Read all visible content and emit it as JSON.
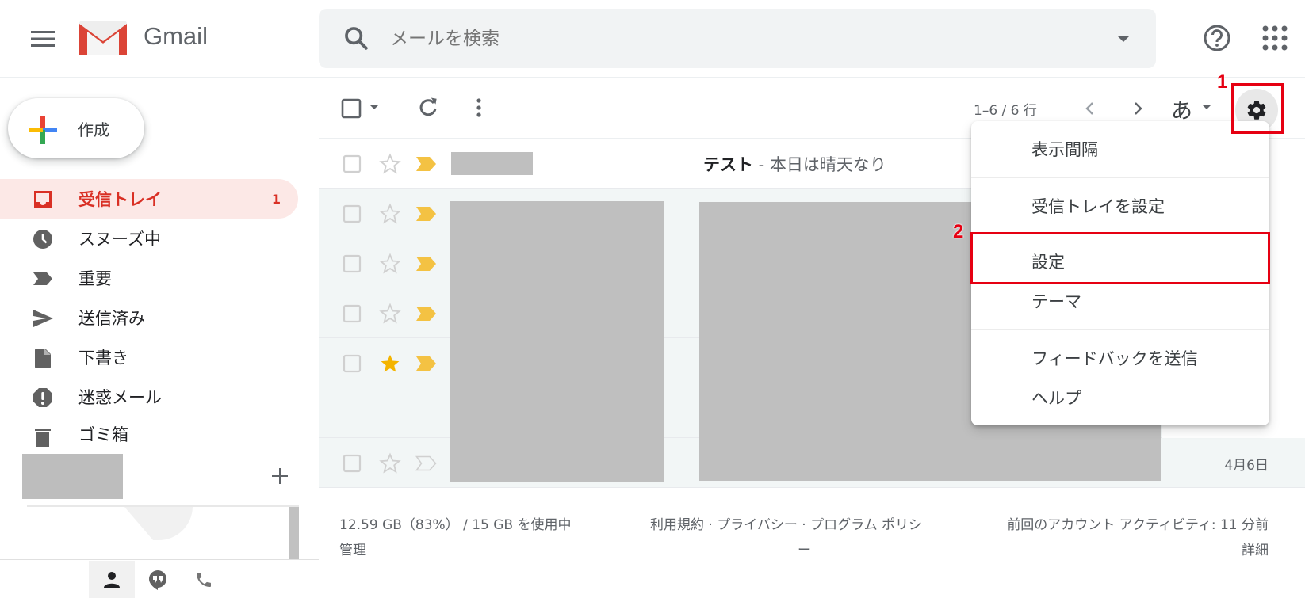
{
  "header": {
    "brand": "Gmail",
    "search_placeholder": "メールを検索"
  },
  "compose": {
    "label": "作成"
  },
  "sidebar": {
    "items": [
      {
        "label": "受信トレイ",
        "count": "1",
        "icon": "inbox-icon",
        "active": true
      },
      {
        "label": "スヌーズ中",
        "icon": "clock-icon"
      },
      {
        "label": "重要",
        "icon": "important-icon"
      },
      {
        "label": "送信済み",
        "icon": "send-icon"
      },
      {
        "label": "下書き",
        "icon": "draft-icon"
      },
      {
        "label": "迷惑メール",
        "icon": "spam-icon"
      },
      {
        "label": "ゴミ箱",
        "icon": "trash-icon"
      }
    ]
  },
  "toolbar": {
    "page_range": "1–6 / 6 行",
    "input_tool": "あ"
  },
  "emails": [
    {
      "subject": "テスト",
      "snippet": " - 本日は晴天なり",
      "starred": false,
      "important": true,
      "unread": true
    },
    {
      "starred": false,
      "important": true
    },
    {
      "starred": false,
      "important": true
    },
    {
      "starred": false,
      "important": true
    },
    {
      "starred": true,
      "important": true
    },
    {
      "starred": false,
      "important": false,
      "date": "4月6日"
    }
  ],
  "settings_menu": {
    "items": [
      "表示間隔",
      "受信トレイを設定",
      "設定",
      "テーマ",
      "フィードバックを送信",
      "ヘルプ"
    ]
  },
  "annotations": {
    "step1": "1",
    "step2": "2",
    "color": "#e60012"
  },
  "footer": {
    "storage": "12.59 GB（83%） / 15 GB を使用中",
    "storage_percent": 83,
    "manage": "管理",
    "links": "利用規約 · プライバシー · プログラム ポリシ",
    "links_cont": "ー",
    "activity": "前回のアカウント アクティビティ: 11 分前",
    "details": "詳細"
  },
  "colors": {
    "accent_red": "#d93025",
    "important_yellow": "#f4c243",
    "star_yellow": "#f4b400",
    "active_bg": "#fce8e6"
  }
}
